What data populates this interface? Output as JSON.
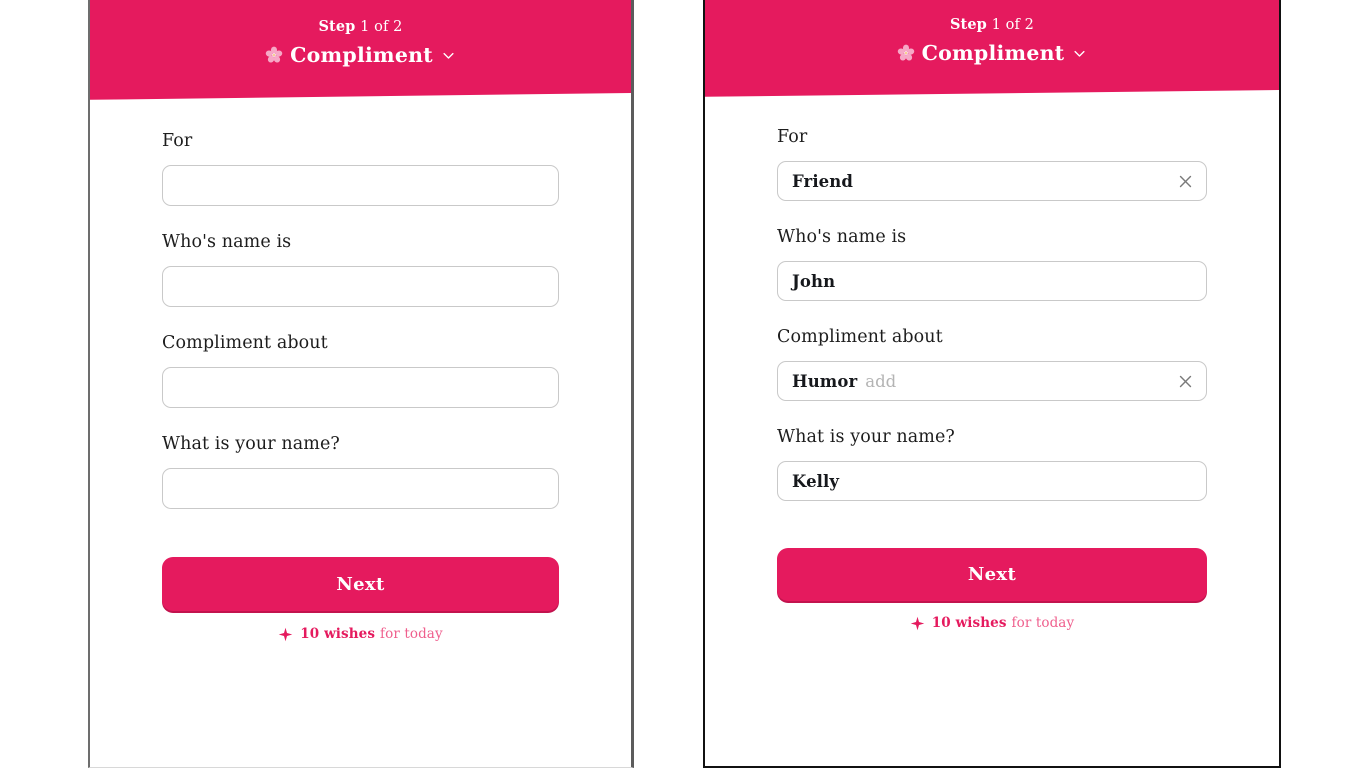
{
  "theme": {
    "accent": "#e51a5e",
    "accent_dark": "#c2134e",
    "accent_light": "#ef5f8d",
    "label_color": "#1d1d1d",
    "value_color": "#16181c",
    "placeholder_color": "#b4b4b4",
    "input_border": "#c9c9c9",
    "clear_icon_color": "#7a7a7a"
  },
  "panels": [
    {
      "id": "empty-state",
      "header": {
        "step_word": "Step",
        "step_rest": " 1 of 2",
        "step_full": "Step 1 of 2",
        "title": "Compliment",
        "flower_icon": "cherry-blossom-icon",
        "chevron_icon": "chevron-down-icon"
      },
      "fields": [
        {
          "label": "For",
          "value": "",
          "placeholder": "",
          "has_clear": false
        },
        {
          "label": "Who's name is",
          "value": "",
          "placeholder": "",
          "has_clear": false
        },
        {
          "label": "Compliment about",
          "value": "",
          "placeholder": "",
          "has_clear": false
        },
        {
          "label": "What is your name?",
          "value": "",
          "placeholder": "",
          "has_clear": false
        }
      ],
      "next_label": "Next",
      "footer": {
        "sparkle_icon": "sparkle-icon",
        "count": "10 wishes",
        "suffix": "for today"
      }
    },
    {
      "id": "filled-state",
      "header": {
        "step_word": "Step",
        "step_rest": " 1 of 2",
        "step_full": "Step 1 of 2",
        "title": "Compliment",
        "flower_icon": "cherry-blossom-icon",
        "chevron_icon": "chevron-down-icon"
      },
      "fields": [
        {
          "label": "For",
          "value": "Friend",
          "placeholder": "",
          "has_clear": true
        },
        {
          "label": "Who's name is",
          "value": "John",
          "placeholder": "",
          "has_clear": false
        },
        {
          "label": "Compliment about",
          "value": "Humor",
          "placeholder": "add",
          "has_clear": true
        },
        {
          "label": "What is your name?",
          "value": "Kelly",
          "placeholder": "",
          "has_clear": false
        }
      ],
      "next_label": "Next",
      "footer": {
        "sparkle_icon": "sparkle-icon",
        "count": "10 wishes",
        "suffix": "for today"
      }
    }
  ]
}
